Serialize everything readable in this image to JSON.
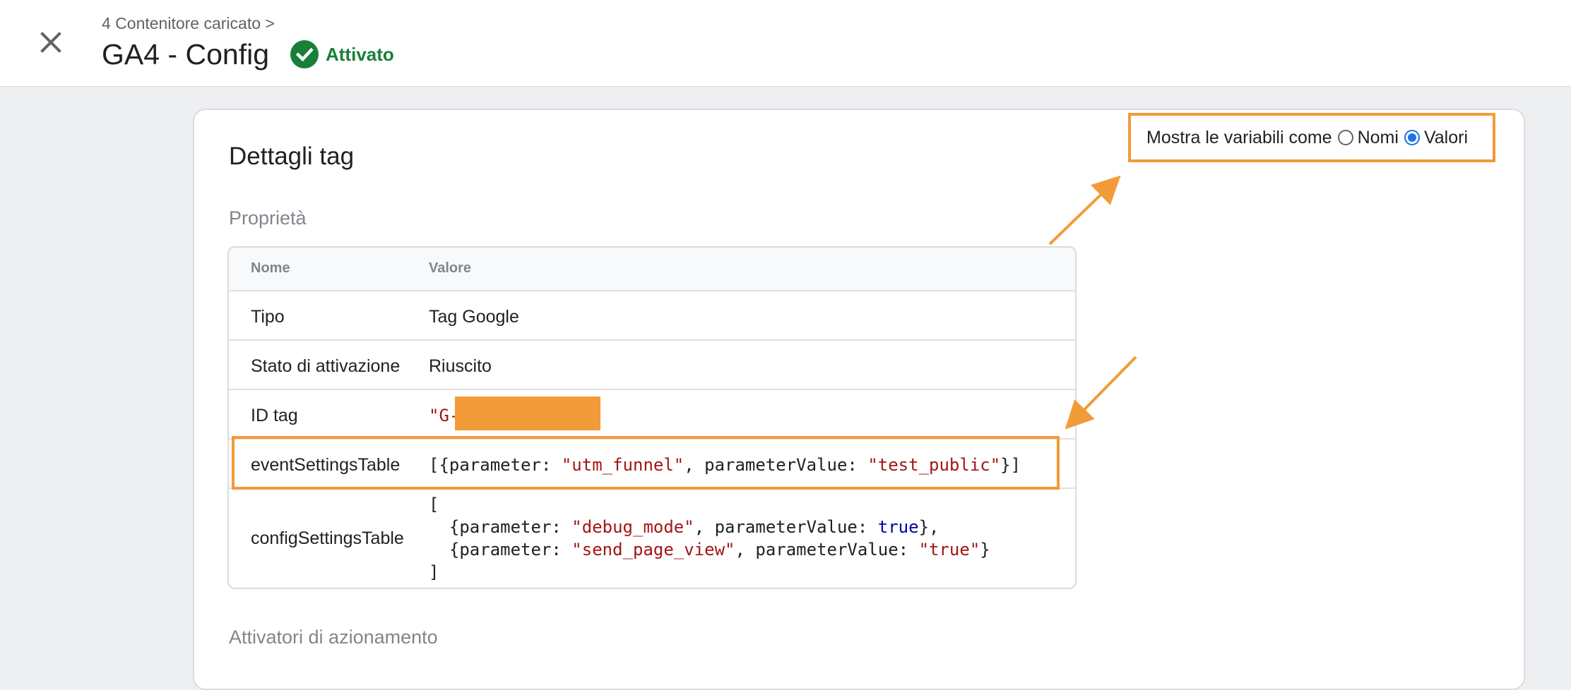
{
  "header": {
    "breadcrumb": "4 Contenitore caricato >",
    "title": "GA4 - Config",
    "status": "Attivato",
    "status_color": "#188038",
    "close_icon": "close-icon"
  },
  "card": {
    "title": "Dettagli tag",
    "properties_title": "Proprietà",
    "triggers_title": "Attivatori di azionamento",
    "toggle": {
      "label": "Mostra le variabili come",
      "options": [
        "Nomi",
        "Valori"
      ],
      "selected": "Valori"
    },
    "table": {
      "headers": [
        "Nome",
        "Valore"
      ],
      "rows": [
        {
          "name": "Tipo",
          "value": "Tag Google"
        },
        {
          "name": "Stato di attivazione",
          "value": "Riuscito"
        },
        {
          "name": "ID tag",
          "value": "\"G-"
        },
        {
          "name": "eventSettingsTable",
          "value": "[{parameter: \"utm_funnel\", parameterValue: \"test_public\"}]"
        },
        {
          "name": "configSettingsTable",
          "value": "[\n  {parameter: \"debug_mode\", parameterValue: true},\n  {parameter: \"send_page_view\", parameterValue: \"true\"}\n]"
        }
      ]
    }
  },
  "annotation_color": "#f29b38"
}
